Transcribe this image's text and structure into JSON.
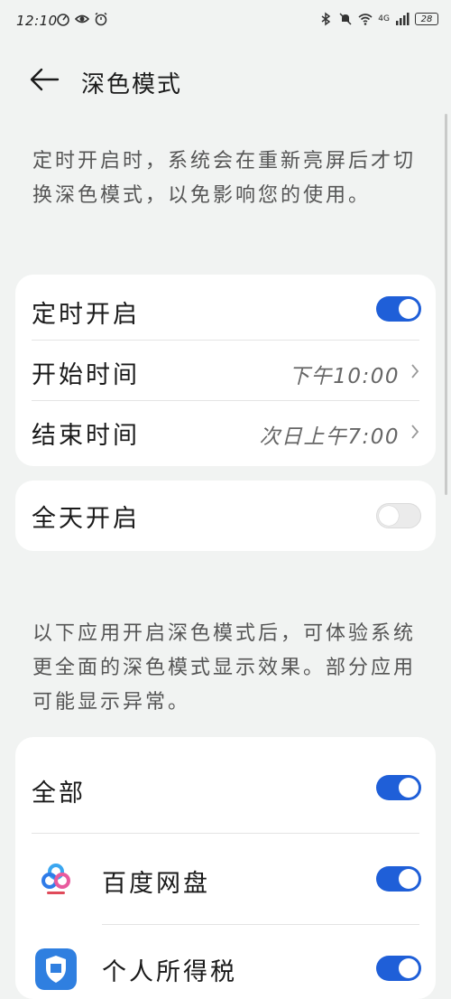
{
  "status": {
    "time": "12:10",
    "signal_label": "4G",
    "battery": "28"
  },
  "header": {
    "title": "深色模式"
  },
  "schedule_desc": "定时开启时，系统会在重新亮屏后才切换深色模式，以免影响您的使用。",
  "schedule_card": {
    "enable_label": "定时开启",
    "enable_on": true,
    "start_label": "开始时间",
    "start_value": "下午10:00",
    "end_label": "结束时间",
    "end_value": "次日上午7:00"
  },
  "allday_card": {
    "label": "全天开启",
    "on": false
  },
  "apps_desc": "以下应用开启深色模式后，可体验系统更全面的深色模式显示效果。部分应用可能显示异常。",
  "apps_card": {
    "all_label": "全部",
    "all_on": true,
    "apps": [
      {
        "name": "百度网盘",
        "icon": "baidu-netdisk-icon",
        "on": true
      },
      {
        "name": "个人所得税",
        "icon": "personal-tax-icon",
        "on": true
      }
    ]
  },
  "colors": {
    "accent": "#1f5fd8",
    "background": "#f1f3f2",
    "card": "#ffffff"
  }
}
